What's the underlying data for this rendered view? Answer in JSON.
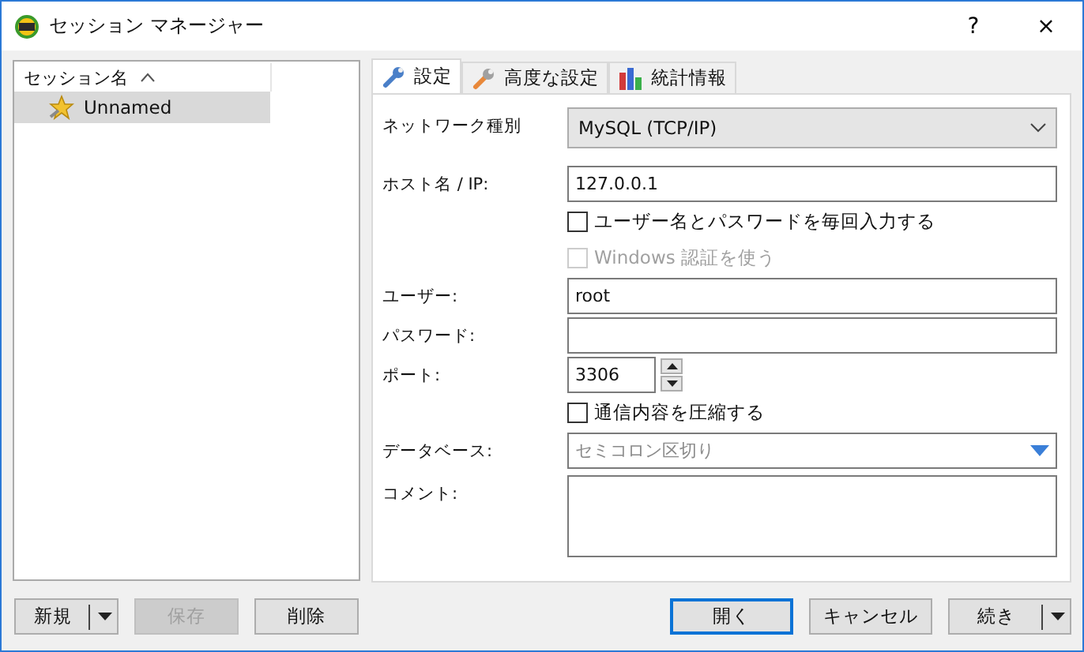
{
  "window": {
    "title": "セッション マネージャー",
    "help": "?",
    "close": "×"
  },
  "sessions": {
    "column": "セッション名",
    "items": [
      {
        "label": "Unnamed",
        "selected": true
      }
    ]
  },
  "tabs": [
    {
      "label": "設定",
      "selected": true,
      "kind": "wrench"
    },
    {
      "label": "高度な設定",
      "selected": false,
      "kind": "spanner"
    },
    {
      "label": "統計情報",
      "selected": false,
      "kind": "chart"
    }
  ],
  "form": [
    {
      "kind": "select",
      "label": "ネットワーク種別",
      "value": "MySQL (TCP/IP)"
    },
    {
      "kind": "text",
      "label": "ホスト名 / IP:",
      "value": "127.0.0.1"
    },
    {
      "kind": "checkbox",
      "text": "ユーザー名とパスワードを毎回入力する",
      "checked": false,
      "disabled": false
    },
    {
      "kind": "checkbox",
      "text": "Windows 認証を使う",
      "checked": false,
      "disabled": true
    },
    {
      "kind": "text",
      "label": "ユーザー:",
      "value": "root"
    },
    {
      "kind": "text",
      "label": "パスワード:"
    },
    {
      "kind": "number",
      "label": "ポート:",
      "value": "3306"
    },
    {
      "kind": "checkbox",
      "text": "通信内容を圧縮する",
      "checked": false,
      "disabled": false
    },
    {
      "kind": "combo",
      "label": "データベース:",
      "placeholder": "セミコロン区切り"
    },
    {
      "kind": "textarea",
      "label": "コメント:"
    }
  ],
  "buttons_left": [
    {
      "label": "新規",
      "kind": "split",
      "disabled": false
    },
    {
      "label": "保存",
      "kind": "plain",
      "disabled": true
    },
    {
      "label": "削除",
      "kind": "plain",
      "disabled": false
    }
  ],
  "buttons_right": [
    {
      "label": "開く",
      "kind": "default",
      "disabled": false
    },
    {
      "label": "キャンセル",
      "kind": "plain",
      "disabled": false
    },
    {
      "label": "続き",
      "kind": "split",
      "disabled": false
    }
  ]
}
